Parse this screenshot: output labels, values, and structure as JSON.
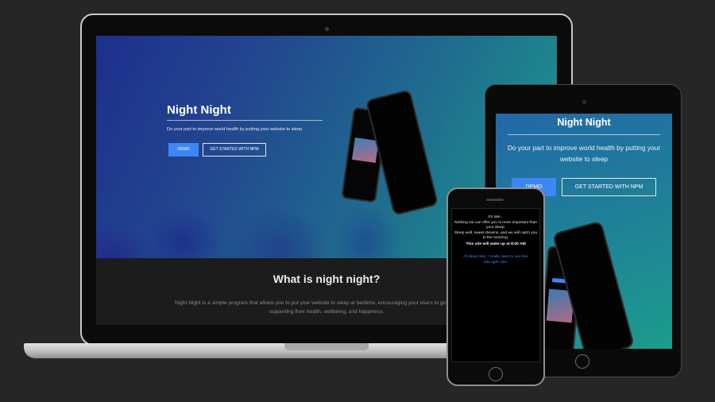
{
  "hero": {
    "title": "Night Night",
    "subtitle": "Do your part to improve world health by putting your website to sleep",
    "demo_label": "DEMO",
    "npm_label": "GET STARTED WITH NPM"
  },
  "about": {
    "title": "What is night night?",
    "body": "Night Night is a simple program that allows you to put your website to sleep at bedtime, encouraging your users to go to bed, better supporting their health, wellbeing, and happiness."
  },
  "tablet": {
    "title": "Night Night",
    "subtitle": "Do your part to improve world health by putting your website to sleep",
    "demo_label": "DEMO",
    "npm_label": "GET STARTED WITH NPM"
  },
  "phone": {
    "message": "It's late...\nNothing we can offer you is more important than your sleep.\nSleep well, sweet dreams, and we will catch you in the morning.",
    "wake": "This site will wake up at 8:00 AM",
    "link": "I'll sleep later, I really need to use this site right now."
  },
  "colors": {
    "accent": "#3d86f5",
    "background": "#262626",
    "hero_start": "#1e2f8c",
    "hero_end": "#1d9a8a"
  }
}
